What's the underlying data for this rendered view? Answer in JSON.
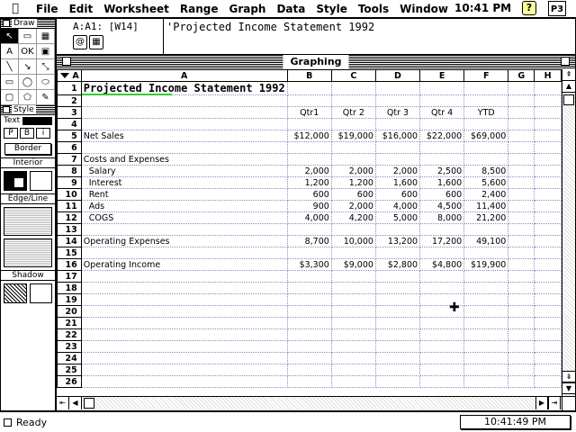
{
  "menubar": {
    "apple": "",
    "items": [
      "File",
      "Edit",
      "Worksheet",
      "Range",
      "Graph",
      "Data",
      "Style",
      "Tools",
      "Window"
    ],
    "clock": "10:41 PM",
    "help": "?",
    "app": "P3"
  },
  "palette": {
    "title": "Draw",
    "tools": [
      "↖",
      "▭",
      "▦",
      "A",
      "OK",
      "▣",
      "╲",
      "↘",
      "⤡",
      "▭",
      "◯",
      "⬭",
      "▢",
      "⬠",
      "✎"
    ],
    "style_title": "Style",
    "text_label": "Text",
    "style_buttons": [
      "P",
      "B",
      "i"
    ],
    "border_label": "Border",
    "interior_label": "Interior",
    "edge_label": "Edge/Line",
    "shadow_label": "Shadow"
  },
  "entry": {
    "cellref": "A:A1: [W14]",
    "text": "'Projected Income Statement 1992",
    "icons": [
      "@",
      "▦"
    ]
  },
  "window": {
    "title": "Graphing"
  },
  "sheet": {
    "columns": [
      "A",
      "A",
      "B",
      "C",
      "D",
      "E",
      "F",
      "G",
      "H"
    ],
    "rows": [
      {
        "n": "1",
        "a": "Projected Income Statement 1992",
        "b": "",
        "c": "",
        "d": "",
        "e": "",
        "f": ""
      },
      {
        "n": "2",
        "a": "",
        "b": "",
        "c": "",
        "d": "",
        "e": "",
        "f": ""
      },
      {
        "n": "3",
        "a": "",
        "b": "Qtr1",
        "c": "Qtr 2",
        "d": "Qtr 3",
        "e": "Qtr 4",
        "f": "YTD"
      },
      {
        "n": "4",
        "a": "",
        "b": "",
        "c": "",
        "d": "",
        "e": "",
        "f": ""
      },
      {
        "n": "5",
        "a": "Net Sales",
        "b": "$12,000",
        "c": "$19,000",
        "d": "$16,000",
        "e": "$22,000",
        "f": "$69,000"
      },
      {
        "n": "6",
        "a": "",
        "b": "",
        "c": "",
        "d": "",
        "e": "",
        "f": ""
      },
      {
        "n": "7",
        "a": "Costs and Expenses",
        "b": "",
        "c": "",
        "d": "",
        "e": "",
        "f": ""
      },
      {
        "n": "8",
        "a": "  Salary",
        "b": "2,000",
        "c": "2,000",
        "d": "2,000",
        "e": "2,500",
        "f": "8,500"
      },
      {
        "n": "9",
        "a": "  Interest",
        "b": "1,200",
        "c": "1,200",
        "d": "1,600",
        "e": "1,600",
        "f": "5,600"
      },
      {
        "n": "10",
        "a": "  Rent",
        "b": "600",
        "c": "600",
        "d": "600",
        "e": "600",
        "f": "2,400"
      },
      {
        "n": "11",
        "a": "  Ads",
        "b": "900",
        "c": "2,000",
        "d": "4,000",
        "e": "4,500",
        "f": "11,400"
      },
      {
        "n": "12",
        "a": "  COGS",
        "b": "4,000",
        "c": "4,200",
        "d": "5,000",
        "e": "8,000",
        "f": "21,200"
      },
      {
        "n": "13",
        "a": "",
        "b": "",
        "c": "",
        "d": "",
        "e": "",
        "f": ""
      },
      {
        "n": "14",
        "a": "Operating Expenses",
        "b": "8,700",
        "c": "10,000",
        "d": "13,200",
        "e": "17,200",
        "f": "49,100"
      },
      {
        "n": "15",
        "a": "",
        "b": "",
        "c": "",
        "d": "",
        "e": "",
        "f": ""
      },
      {
        "n": "16",
        "a": "Operating Income",
        "b": "$3,300",
        "c": "$9,000",
        "d": "$2,800",
        "e": "$4,800",
        "f": "$19,900"
      },
      {
        "n": "17",
        "a": "",
        "b": "",
        "c": "",
        "d": "",
        "e": "",
        "f": ""
      },
      {
        "n": "18",
        "a": "",
        "b": "",
        "c": "",
        "d": "",
        "e": "",
        "f": ""
      },
      {
        "n": "19",
        "a": "",
        "b": "",
        "c": "",
        "d": "",
        "e": "",
        "f": ""
      },
      {
        "n": "20",
        "a": "",
        "b": "",
        "c": "",
        "d": "",
        "e": "",
        "f": ""
      },
      {
        "n": "21",
        "a": "",
        "b": "",
        "c": "",
        "d": "",
        "e": "",
        "f": ""
      },
      {
        "n": "22",
        "a": "",
        "b": "",
        "c": "",
        "d": "",
        "e": "",
        "f": ""
      },
      {
        "n": "23",
        "a": "",
        "b": "",
        "c": "",
        "d": "",
        "e": "",
        "f": ""
      },
      {
        "n": "24",
        "a": "",
        "b": "",
        "c": "",
        "d": "",
        "e": "",
        "f": ""
      },
      {
        "n": "25",
        "a": "",
        "b": "",
        "c": "",
        "d": "",
        "e": "",
        "f": ""
      },
      {
        "n": "26",
        "a": "",
        "b": "",
        "c": "",
        "d": "",
        "e": "",
        "f": ""
      }
    ]
  },
  "status": {
    "text": "Ready",
    "time": "10:41:49 PM"
  }
}
